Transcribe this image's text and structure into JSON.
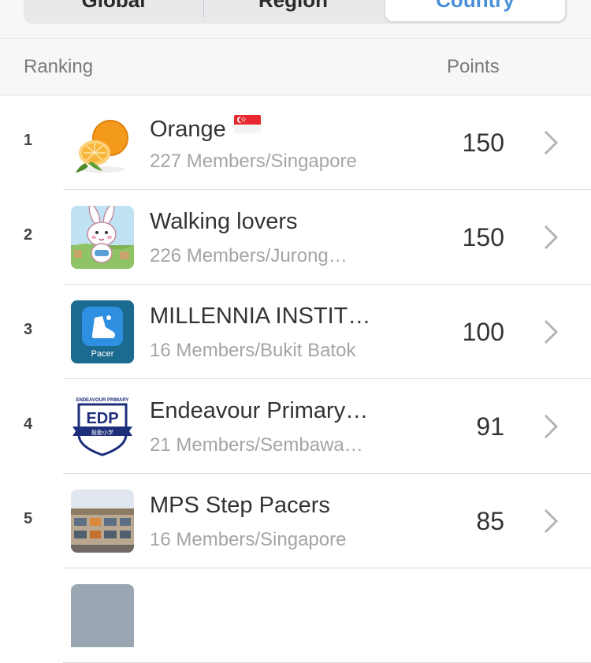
{
  "tabs": [
    {
      "label": "Global"
    },
    {
      "label": "Region"
    },
    {
      "label": "Country"
    }
  ],
  "header": {
    "ranking": "Ranking",
    "points": "Points"
  },
  "colors": {
    "accent": "#4a90d9",
    "subtext": "#a5a5a5",
    "header_bg": "#f7f7f7"
  },
  "rows": [
    {
      "rank": "1",
      "name": "Orange",
      "sub": "227 Members/Singapore",
      "points": "150",
      "avatar": "orange-fruit"
    },
    {
      "rank": "2",
      "name": "Walking lovers",
      "sub": "226 Members/Jurong…",
      "points": "150",
      "avatar": "bunny-cartoon"
    },
    {
      "rank": "3",
      "name": "MILLENNIA INSTIT…",
      "sub": "16 Members/Bukit Batok",
      "points": "100",
      "avatar": "pacer-app-logo",
      "avatar_text": "Pacer"
    },
    {
      "rank": "4",
      "name": "Endeavour Primary…",
      "sub": "21 Members/Sembawa…",
      "points": "91",
      "avatar": "edp-crest",
      "avatar_text": "EDP",
      "avatar_top_text": "ENDEAVOUR PRIMARY",
      "avatar_ribbon_text": "殷勤小学"
    },
    {
      "rank": "5",
      "name": "MPS Step Pacers",
      "sub": "16 Members/Singapore",
      "points": "85",
      "avatar": "school-building-photo"
    }
  ]
}
